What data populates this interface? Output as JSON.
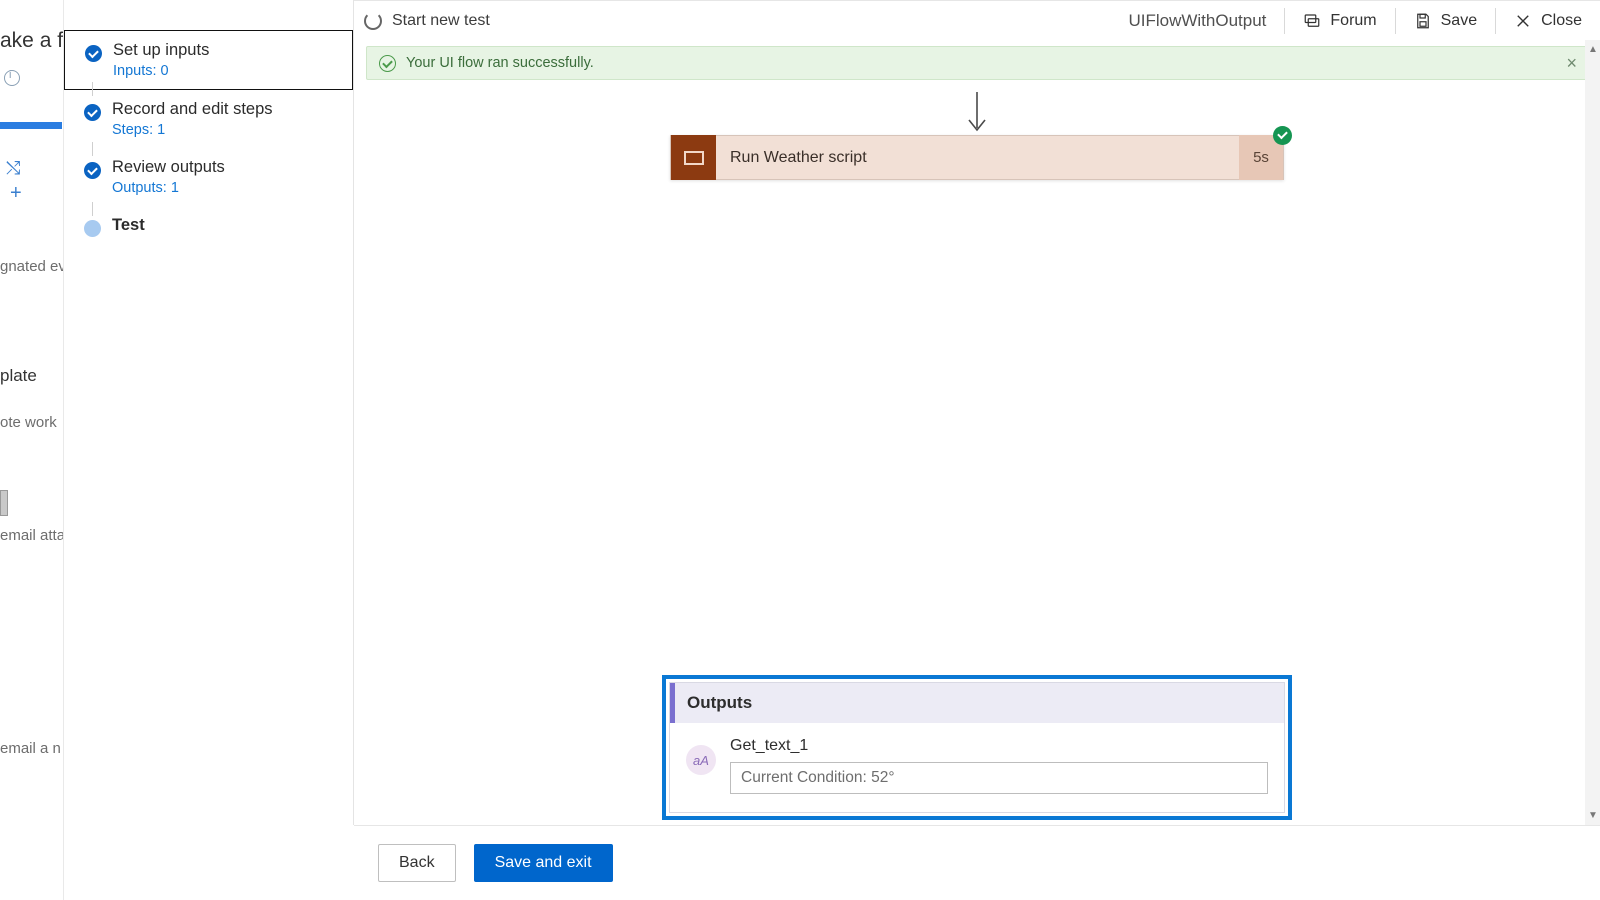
{
  "bgpanel": {
    "heading": "ake a fl",
    "frag1": "gnated even",
    "frag2": "plate",
    "frag3": "ote work",
    "frag4": "email attac",
    "frag5": "email a n"
  },
  "header": {
    "start_new_test": "Start new test",
    "flow_name": "UIFlowWithOutput",
    "forum": "Forum",
    "save": "Save",
    "close": "Close"
  },
  "steps": [
    {
      "title": "Set up inputs",
      "subtitle": "Inputs: 0",
      "state": "done",
      "boxed": true
    },
    {
      "title": "Record and edit steps",
      "subtitle": "Steps: 1",
      "state": "done",
      "boxed": false
    },
    {
      "title": "Review outputs",
      "subtitle": "Outputs: 1",
      "state": "done",
      "boxed": false
    },
    {
      "title": "Test",
      "subtitle": "",
      "state": "current",
      "boxed": false
    }
  ],
  "banner": {
    "message": "Your UI flow ran successfully."
  },
  "action_card": {
    "title": "Run Weather script",
    "duration": "5s"
  },
  "outputs": {
    "heading": "Outputs",
    "items": [
      {
        "name": "Get_text_1",
        "value": "Current Condition: 52°"
      }
    ]
  },
  "footer": {
    "back": "Back",
    "save_exit": "Save and exit"
  }
}
